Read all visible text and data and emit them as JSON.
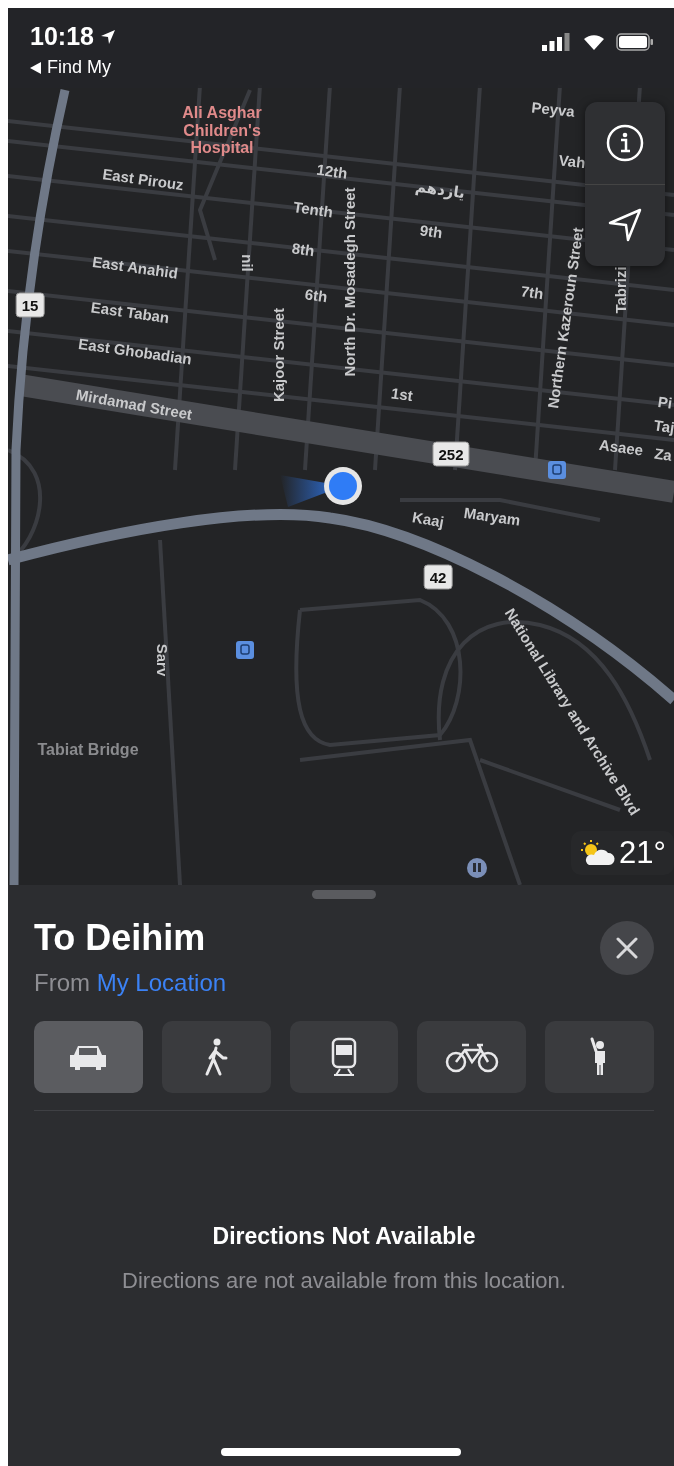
{
  "status_bar": {
    "time": "10:18",
    "back_label": "Find My"
  },
  "map": {
    "labels": [
      {
        "text": "Ali Asghar Children's Hospital",
        "kind": "poi"
      },
      {
        "text": "Peyva",
        "kind": "street"
      },
      {
        "text": "Vah",
        "kind": "street"
      },
      {
        "text": "East Pirouz",
        "kind": "street"
      },
      {
        "text": "12th",
        "kind": "street"
      },
      {
        "text": "Tenth",
        "kind": "street"
      },
      {
        "text": "یازدهم",
        "kind": "street"
      },
      {
        "text": "9th",
        "kind": "street"
      },
      {
        "text": "8th",
        "kind": "street"
      },
      {
        "text": "East Anahid",
        "kind": "street"
      },
      {
        "text": "nil",
        "kind": "street"
      },
      {
        "text": "North Dr. Mosadegh Street",
        "kind": "street"
      },
      {
        "text": "Northern Kazeroun Street",
        "kind": "street"
      },
      {
        "text": "Tabrizi",
        "kind": "street"
      },
      {
        "text": "6th",
        "kind": "street"
      },
      {
        "text": "7th",
        "kind": "street"
      },
      {
        "text": "East Taban",
        "kind": "street"
      },
      {
        "text": "East Ghobadian",
        "kind": "street"
      },
      {
        "text": "Kajoor Street",
        "kind": "street"
      },
      {
        "text": "Mirdamad Street",
        "kind": "street"
      },
      {
        "text": "1st",
        "kind": "street"
      },
      {
        "text": "Pi",
        "kind": "street"
      },
      {
        "text": "Taj",
        "kind": "street"
      },
      {
        "text": "Asaee",
        "kind": "street"
      },
      {
        "text": "Za",
        "kind": "street"
      },
      {
        "text": "Kaaj",
        "kind": "street"
      },
      {
        "text": "Maryam",
        "kind": "street"
      },
      {
        "text": "National Library and Archive Blvd",
        "kind": "street"
      },
      {
        "text": "Sarv",
        "kind": "street"
      },
      {
        "text": "Tabiat Bridge",
        "kind": "area"
      }
    ],
    "shields": [
      "15",
      "252",
      "42"
    ],
    "weather": {
      "temperature": "21°"
    }
  },
  "sheet": {
    "title": "To Deihim",
    "from_label": "From",
    "from_value": "My Location",
    "modes": [
      {
        "kind": "car",
        "selected": true
      },
      {
        "kind": "walk",
        "selected": false
      },
      {
        "kind": "transit",
        "selected": false
      },
      {
        "kind": "bike",
        "selected": false
      },
      {
        "kind": "rideshare",
        "selected": false
      }
    ],
    "message_title": "Directions Not Available",
    "message_body": "Directions are not available from this location."
  }
}
